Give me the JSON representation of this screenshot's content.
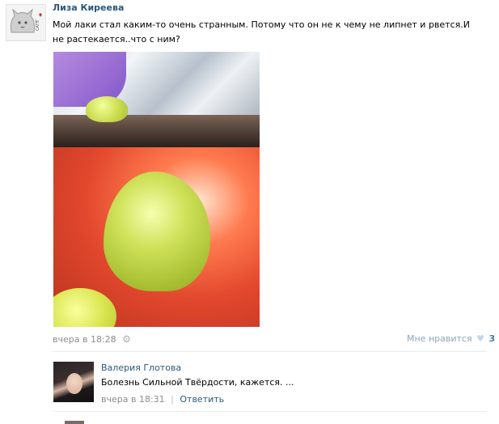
{
  "post": {
    "author": "Лиза Киреева",
    "text": "Мой лаки стал каким-то очень странным. Потому что он не к чему не липнет и рвется.И не растекается..что с ним?",
    "timestamp": "вчера в 18:28",
    "like_label": "Мне нравится",
    "like_count": "3"
  },
  "comment": {
    "author": "Валерия Глотова",
    "text": "Болезнь Сильной Твёрдости, кажется. ...",
    "timestamp": "вчера в 18:31",
    "separator": "|",
    "reply_label": "Ответить"
  },
  "avatar_logo": {
    "text_i": "I",
    "text_cats": "CATS"
  },
  "colors": {
    "link": "#2b587a",
    "meta": "#8c8c8c",
    "like_count": "#4b78a6"
  },
  "icons": {
    "settings": "gear-icon",
    "like": "heart-icon"
  }
}
